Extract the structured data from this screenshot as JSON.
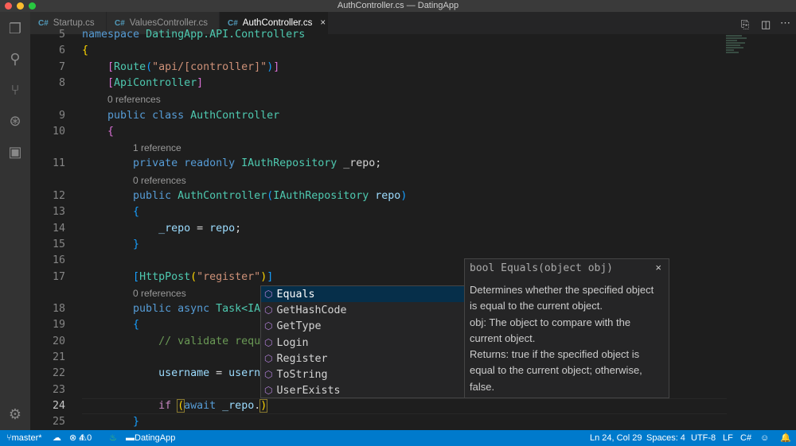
{
  "window": {
    "title": "AuthController.cs — DatingApp"
  },
  "tabs": [
    {
      "icon": "C#",
      "label": "Startup.cs",
      "active": false
    },
    {
      "icon": "C#",
      "label": "ValuesController.cs",
      "active": false
    },
    {
      "icon": "C#",
      "label": "AuthController.cs",
      "active": true,
      "close": "×"
    }
  ],
  "editor": {
    "rows": [
      {
        "n": "5",
        "t": [
          [
            "namespace ",
            "kw"
          ],
          [
            "DatingApp.API.Controllers",
            "ty"
          ]
        ]
      },
      {
        "n": "6",
        "t": [
          [
            "{",
            "b1"
          ]
        ]
      },
      {
        "n": "7",
        "t": [
          [
            "    ",
            "pl"
          ],
          [
            "[",
            "b2"
          ],
          [
            "Route",
            "ty"
          ],
          [
            "(",
            "b3"
          ],
          [
            "\"api/[controller]\"",
            "st"
          ],
          [
            ")",
            "b3"
          ],
          [
            "]",
            "b2"
          ]
        ]
      },
      {
        "n": "8",
        "t": [
          [
            "    ",
            "pl"
          ],
          [
            "[",
            "b2"
          ],
          [
            "ApiController",
            "ty"
          ],
          [
            "]",
            "b2"
          ]
        ]
      },
      {
        "lens": "0 references",
        "indent": 4
      },
      {
        "n": "9",
        "t": [
          [
            "    ",
            "pl"
          ],
          [
            "public class ",
            "kw"
          ],
          [
            "AuthController",
            "ty"
          ]
        ]
      },
      {
        "n": "10",
        "t": [
          [
            "    ",
            "pl"
          ],
          [
            "{",
            "b2"
          ]
        ]
      },
      {
        "lens": "1 reference",
        "indent": 8
      },
      {
        "n": "11",
        "t": [
          [
            "        ",
            "pl"
          ],
          [
            "private readonly ",
            "kw"
          ],
          [
            "IAuthRepository ",
            "ty"
          ],
          [
            "_repo;",
            "pl"
          ]
        ]
      },
      {
        "lens": "0 references",
        "indent": 8
      },
      {
        "n": "12",
        "t": [
          [
            "        ",
            "pl"
          ],
          [
            "public ",
            "kw"
          ],
          [
            "AuthController",
            "ty"
          ],
          [
            "(",
            "b3"
          ],
          [
            "IAuthRepository ",
            "ty"
          ],
          [
            "repo",
            "va"
          ],
          [
            ")",
            "b3"
          ]
        ]
      },
      {
        "n": "13",
        "t": [
          [
            "        ",
            "pl"
          ],
          [
            "{",
            "b3"
          ]
        ]
      },
      {
        "n": "14",
        "t": [
          [
            "            ",
            "pl"
          ],
          [
            "_repo",
            "va"
          ],
          [
            " = ",
            "pl"
          ],
          [
            "repo",
            "va"
          ],
          [
            ";",
            "pl"
          ]
        ]
      },
      {
        "n": "15",
        "t": [
          [
            "        ",
            "pl"
          ],
          [
            "}",
            "b3"
          ]
        ]
      },
      {
        "n": "16",
        "t": []
      },
      {
        "n": "17",
        "t": [
          [
            "        ",
            "pl"
          ],
          [
            "[",
            "b3"
          ],
          [
            "HttpPost",
            "ty"
          ],
          [
            "(",
            "b1"
          ],
          [
            "\"register\"",
            "st"
          ],
          [
            ")",
            "b1"
          ],
          [
            "]",
            "b3"
          ]
        ]
      },
      {
        "lens": "0 references",
        "indent": 8
      },
      {
        "n": "18",
        "t": [
          [
            "        ",
            "pl"
          ],
          [
            "public async ",
            "kw"
          ],
          [
            "Task",
            "ty"
          ],
          [
            "<IA",
            "ty"
          ]
        ]
      },
      {
        "n": "19",
        "t": [
          [
            "        ",
            "pl"
          ],
          [
            "{",
            "b3"
          ]
        ]
      },
      {
        "n": "20",
        "t": [
          [
            "            ",
            "pl"
          ],
          [
            "// validate requ",
            "cm"
          ]
        ]
      },
      {
        "n": "21",
        "t": []
      },
      {
        "n": "22",
        "t": [
          [
            "            ",
            "pl"
          ],
          [
            "username",
            "va"
          ],
          [
            " = ",
            "pl"
          ],
          [
            "usern",
            "va"
          ]
        ]
      },
      {
        "n": "23",
        "t": []
      },
      {
        "n": "24",
        "t": [
          [
            "            ",
            "pl"
          ],
          [
            "if ",
            "ctl"
          ],
          [
            "(",
            "b1"
          ],
          [
            "await ",
            "kw"
          ],
          [
            "_repo",
            "va"
          ],
          [
            ".",
            "pl"
          ],
          [
            ")",
            "b1"
          ]
        ],
        "current": true
      },
      {
        "n": "25",
        "t": [
          [
            "        ",
            "pl"
          ],
          [
            "}",
            "b3"
          ]
        ]
      }
    ]
  },
  "suggest": {
    "items": [
      "Equals",
      "GetHashCode",
      "GetType",
      "Login",
      "Register",
      "ToString",
      "UserExists"
    ],
    "selected": 0,
    "icon": "method-cube-icon"
  },
  "docs": {
    "signature": "bool Equals(object obj)",
    "close": "×",
    "body": "Determines whether the specified object is equal to the current object.\nobj: The object to compare with the current object.\nReturns: true if the specified object  is equal to the current object; otherwise, false."
  },
  "status": {
    "branch": "master*",
    "errors": "4",
    "warnings": "0",
    "folder": "DatingApp",
    "position": "Ln 24, Col 29",
    "spaces": "Spaces: 4",
    "encoding": "UTF-8",
    "eol": "LF",
    "language": "C#"
  },
  "colors": {
    "statusbar": "#007acc",
    "selection": "#062f4a",
    "keyword": "#569cd6",
    "type": "#4ec9b0",
    "string": "#ce9178"
  }
}
